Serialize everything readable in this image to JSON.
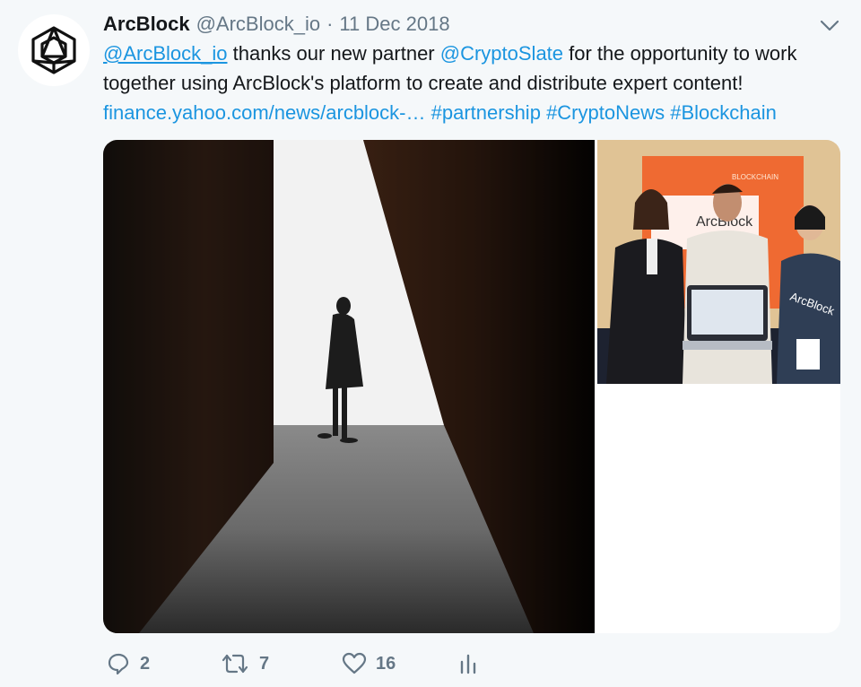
{
  "tweet": {
    "display_name": "ArcBlock",
    "handle": "@ArcBlock_io",
    "separator": "·",
    "date": "11 Dec 2018",
    "text": {
      "mention1": "@ArcBlock_io",
      "part1": " thanks our new partner ",
      "mention2": "@CryptoSlate",
      "part2": " for the opportunity to work",
      "line2": "together using ArcBlock's platform to create and distribute expert content!",
      "url": "finance.yahoo.com/news/arcblock-…",
      "hashtag1": "#partnership",
      "hashtag2": "#CryptoNews",
      "hashtag3": "#Blockchain"
    },
    "media": {
      "photo1_banner_text": "",
      "photo2_banner_text": "ArcBlock",
      "photo2_sign_text": "BLOCKCHAIN",
      "photo2_shirt_text": "ArcBlock"
    },
    "actions": {
      "reply_count": "2",
      "retweet_count": "7",
      "like_count": "16"
    }
  },
  "colors": {
    "link": "#1b95e0",
    "secondary_text": "#657786",
    "background": "#f5f8fa"
  },
  "icons": [
    "arcblock-logo-icon",
    "chevron-down-icon",
    "reply-icon",
    "retweet-icon",
    "like-icon",
    "analytics-icon"
  ]
}
